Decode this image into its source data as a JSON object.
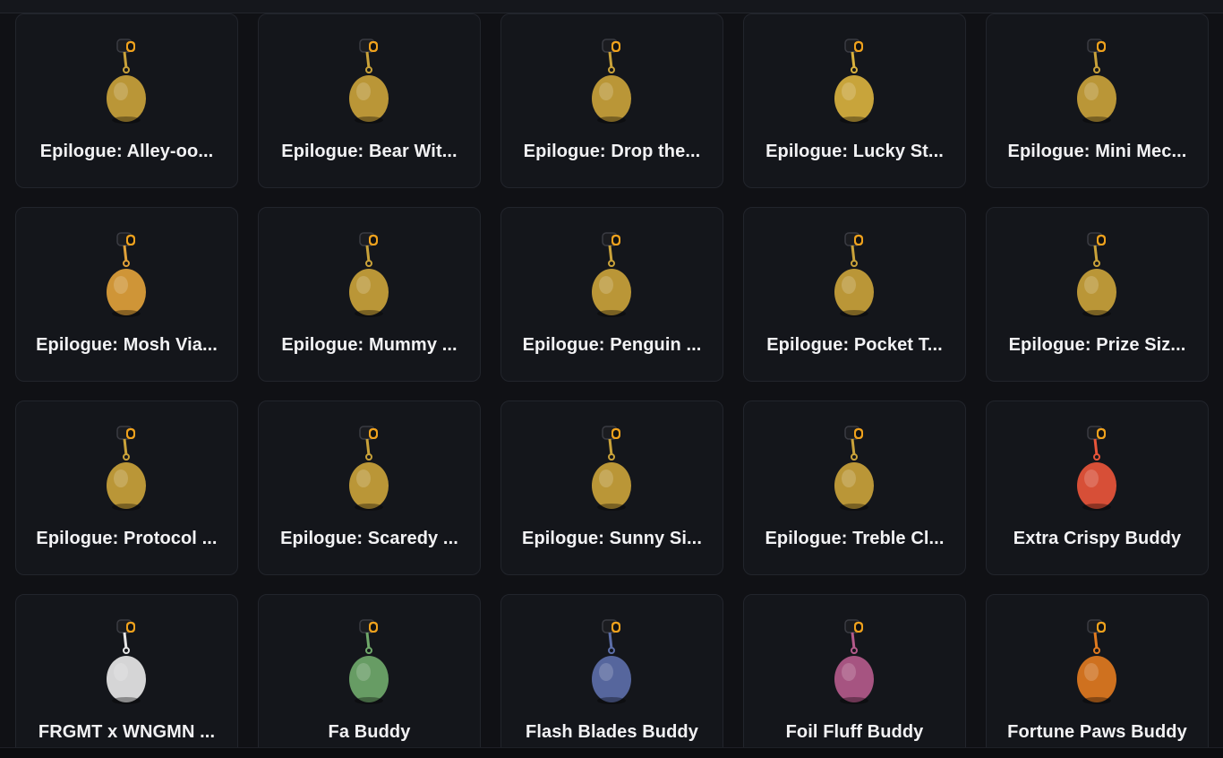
{
  "items": [
    {
      "name": "Epilogue: Alley-oop",
      "icon": "basketball-hoop-charm-icon",
      "color": "#c9a23a"
    },
    {
      "name": "Epilogue: Bear With Me",
      "icon": "bear-head-charm-icon",
      "color": "#c9a23a"
    },
    {
      "name": "Epilogue: Drop the Beat",
      "icon": "monster-truck-charm-icon",
      "color": "#c9a23a"
    },
    {
      "name": "Epilogue: Lucky Star",
      "icon": "star-charm-icon",
      "color": "#d8b13e"
    },
    {
      "name": "Epilogue: Mini Mech",
      "icon": "robot-mech-charm-icon",
      "color": "#c9a23a"
    },
    {
      "name": "Epilogue: Mosh Vial",
      "icon": "potion-vial-charm-icon",
      "color": "#e0a13a"
    },
    {
      "name": "Epilogue: Mummy Cat",
      "icon": "cat-figure-charm-icon",
      "color": "#c9a23a"
    },
    {
      "name": "Epilogue: Penguin Pod",
      "icon": "bowl-figure-charm-icon",
      "color": "#c9a23a"
    },
    {
      "name": "Epilogue: Pocket Tamagotchi",
      "icon": "pocket-device-charm-icon",
      "color": "#c9a23a"
    },
    {
      "name": "Epilogue: Prize Sized",
      "icon": "astronaut-charm-icon",
      "color": "#c9a23a"
    },
    {
      "name": "Epilogue: Protocol Droid",
      "icon": "robot-runner-charm-icon",
      "color": "#c9a23a"
    },
    {
      "name": "Epilogue: Scaredy Cat",
      "icon": "owl-figure-charm-icon",
      "color": "#c9a23a"
    },
    {
      "name": "Epilogue: Sunny Side Up",
      "icon": "frying-pan-egg-charm-icon",
      "color": "#c9a23a"
    },
    {
      "name": "Epilogue: Treble Clef",
      "icon": "treble-clef-charm-icon",
      "color": "#c9a23a"
    },
    {
      "name": "Extra Crispy Buddy",
      "icon": "fries-box-charm-icon",
      "color": "#e8553a"
    },
    {
      "name": "FRGMT x WNGMN Buddy",
      "icon": "lightning-bear-charm-icon",
      "color": "#e6e6e6"
    },
    {
      "name": "Fa Buddy",
      "icon": "mahjong-tile-charm-icon",
      "color": "#6fa86a"
    },
    {
      "name": "Flash Blades Buddy",
      "icon": "skater-figure-charm-icon",
      "color": "#5c6ea8"
    },
    {
      "name": "Foil Fluff Buddy",
      "icon": "foil-card-charm-icon",
      "color": "#b35a8a"
    },
    {
      "name": "Fortune Paws Buddy",
      "icon": "tiger-charm-icon",
      "color": "#e07a1f"
    }
  ],
  "display_names": [
    "Epilogue: Alley-oo...",
    "Epilogue: Bear Wit...",
    "Epilogue: Drop the...",
    "Epilogue: Lucky St...",
    "Epilogue: Mini Mec...",
    "Epilogue: Mosh Via...",
    "Epilogue: Mummy ...",
    "Epilogue: Penguin ...",
    "Epilogue: Pocket T...",
    "Epilogue: Prize Siz...",
    "Epilogue: Protocol ...",
    "Epilogue: Scaredy ...",
    "Epilogue: Sunny Si...",
    "Epilogue: Treble Cl...",
    "Extra Crispy Buddy",
    "FRGMT x WNGMN ...",
    "Fa Buddy",
    "Flash Blades Buddy",
    "Foil Fluff Buddy",
    "Fortune Paws Buddy"
  ],
  "theme": {
    "background": "#101115",
    "card": "#14161b",
    "card_border": "#22252c",
    "text": "#f2f2f4",
    "gold": "#c9a23a",
    "clip": "#f0a21d"
  }
}
